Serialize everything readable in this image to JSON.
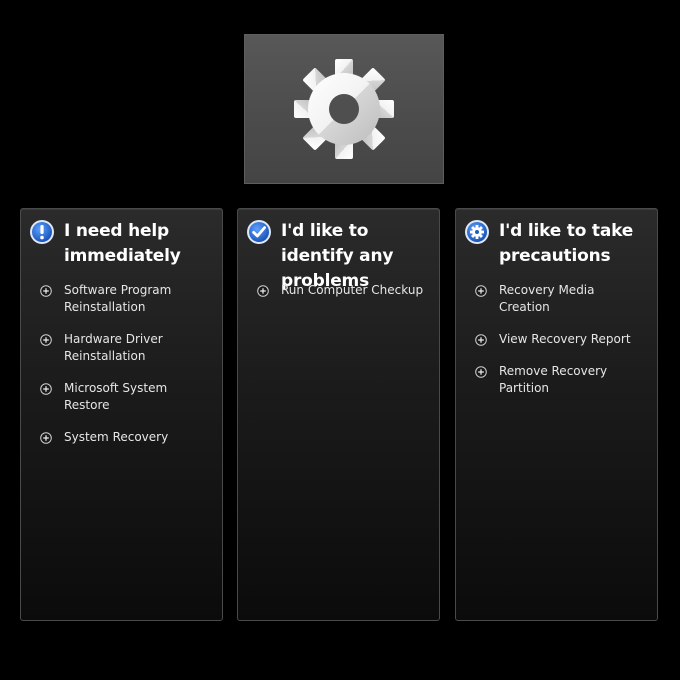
{
  "logo": {
    "icon": "gear-icon"
  },
  "panels": [
    {
      "title": "I need help immediately",
      "icon": "exclamation-icon",
      "items": [
        {
          "label": "Software Program Reinstallation"
        },
        {
          "label": "Hardware Driver Reinstallation"
        },
        {
          "label": "Microsoft System Restore"
        },
        {
          "label": "System Recovery"
        }
      ]
    },
    {
      "title": "I'd like to identify any problems",
      "icon": "checkmark-icon",
      "items": [
        {
          "label": "Run Computer Checkup"
        }
      ]
    },
    {
      "title": "I'd like to take precautions",
      "icon": "gear-icon",
      "items": [
        {
          "label": "Recovery Media Creation"
        },
        {
          "label": "View Recovery Report"
        },
        {
          "label": "Remove Recovery Partition"
        }
      ]
    }
  ],
  "colors": {
    "background": "#000000",
    "panel_border": "#4a4a4a",
    "icon_blue": "#1e63c4",
    "text": "#ffffff"
  }
}
